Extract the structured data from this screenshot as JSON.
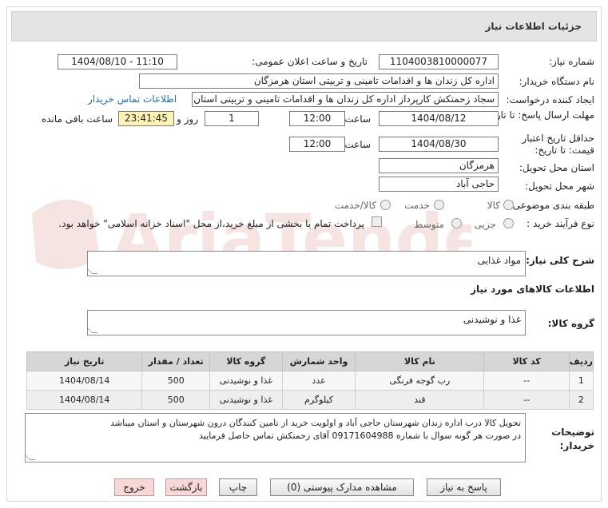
{
  "header": {
    "title": "جزئیات اطلاعات نیاز"
  },
  "fields": {
    "need_number_label": "شماره نیاز:",
    "need_number": "1104003810000077",
    "announce_label": "تاریخ و ساعت اعلان عمومی:",
    "announce_value": "1404/08/10 - 11:10",
    "buyer_org_label": "نام دستگاه خریدار:",
    "buyer_org": "اداره کل زندان ها و اقدامات تامینی و تربیتی استان هرمزگان",
    "requester_label": "ایجاد کننده درخواست:",
    "requester": "سجاد زحمتکش کارپرداز اداره کل زندان ها و اقدامات تامینی و تربیتی استان هرمزگان",
    "contact_link": "اطلاعات تماس خریدار",
    "send_deadline_label": "مهلت ارسال پاسخ: تا تاریخ:",
    "send_date": "1404/08/12",
    "time_label": "ساعت",
    "send_time": "12:00",
    "days_value": "1",
    "days_label": "روز و",
    "remaining_time": "23:41:45",
    "remaining_label": "ساعت باقی مانده",
    "price_deadline_label": "حداقل تاریخ اعتبار قیمت: تا تاریخ:",
    "price_date": "1404/08/30",
    "price_time": "12:00",
    "province_label": "استان محل تحویل:",
    "province": "هرمزگان",
    "city_label": "شهر محل تحویل:",
    "city": "حاجی آباد",
    "category_label": "طبقه بندی موضوعی:",
    "category_options": [
      "کالا",
      "خدمت",
      "کالا/خدمت"
    ],
    "process_label": "نوع فرآیند خرید :",
    "process_options": [
      "جزیی",
      "متوسط"
    ],
    "payment_note": "پرداخت تمام یا بخشی از مبلغ خرید،از محل \"اسناد خزانه اسلامی\" خواهد بود."
  },
  "description": {
    "label": "شرح کلی نیاز:",
    "value": "مواد غذایی"
  },
  "items_section": {
    "title": "اطلاعات کالاهای مورد نیاز"
  },
  "goods_group": {
    "label": "گروه کالا:",
    "value": "غذا و نوشیدنی"
  },
  "table": {
    "headers": [
      "ردیف",
      "کد کالا",
      "نام کالا",
      "واحد شمارش",
      "گروه کالا",
      "تعداد / مقدار",
      "تاریخ نیاز"
    ],
    "rows": [
      [
        "1",
        "--",
        "رب گوجه فرنگی",
        "عدد",
        "غذا و نوشیدنی",
        "500",
        "1404/08/14"
      ],
      [
        "2",
        "--",
        "قند",
        "کیلوگرم",
        "غذا و نوشیدنی",
        "500",
        "1404/08/14"
      ]
    ]
  },
  "buyer_notes": {
    "label": "توضیحات خریدار:",
    "line1": "تحویل کالا درب اداره زندان شهرستان حاجی آباد و اولویت خرید از تامین کنندگان درون شهرستان و استان میباشد",
    "line2": "در صورت هر گونه سوال با شماره 09171604988 آقای زحمتکش تماس حاصل فرمایید"
  },
  "buttons": {
    "reply": "پاسخ به نیاز",
    "docs": "مشاهده مدارک پیوستی (0)",
    "print": "چاپ",
    "back": "بازگشت",
    "exit": "خروج"
  },
  "watermark": "AriaTender.net"
}
